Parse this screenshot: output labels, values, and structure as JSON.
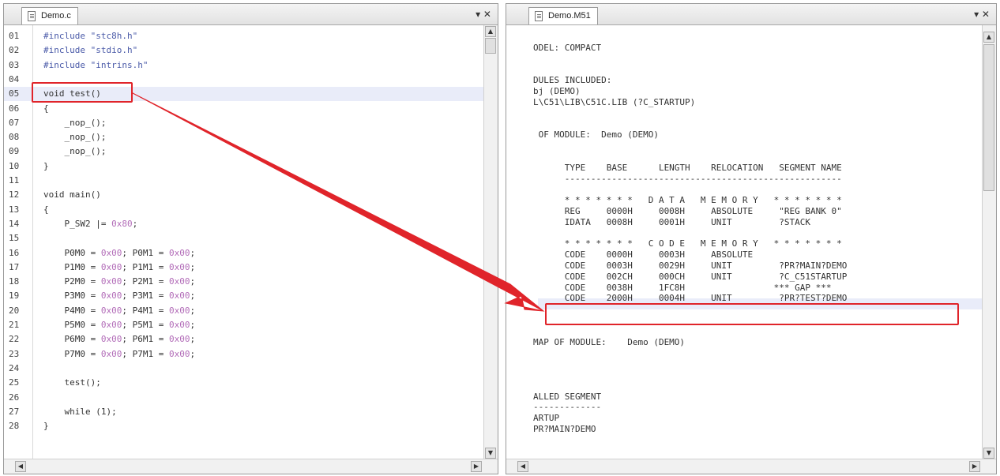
{
  "left_pane": {
    "tab_title": "Demo.c",
    "tab_controls": "▾ ✕",
    "code_lines": [
      {
        "n": "01",
        "parts": [
          {
            "t": "#include \"stc8h.h\"",
            "c": "pp"
          }
        ]
      },
      {
        "n": "02",
        "parts": [
          {
            "t": "#include \"stdio.h\"",
            "c": "pp"
          }
        ]
      },
      {
        "n": "03",
        "parts": [
          {
            "t": "#include \"intrins.h\"",
            "c": "pp"
          }
        ]
      },
      {
        "n": "04",
        "parts": []
      },
      {
        "n": "05",
        "parts": [
          {
            "t": "void test()",
            "c": ""
          }
        ]
      },
      {
        "n": "06",
        "parts": [
          {
            "t": "{",
            "c": ""
          }
        ]
      },
      {
        "n": "07",
        "parts": [
          {
            "t": "    _nop_();",
            "c": ""
          }
        ]
      },
      {
        "n": "08",
        "parts": [
          {
            "t": "    _nop_();",
            "c": ""
          }
        ]
      },
      {
        "n": "09",
        "parts": [
          {
            "t": "    _nop_();",
            "c": ""
          }
        ]
      },
      {
        "n": "10",
        "parts": [
          {
            "t": "}",
            "c": ""
          }
        ]
      },
      {
        "n": "11",
        "parts": []
      },
      {
        "n": "12",
        "parts": [
          {
            "t": "void main()",
            "c": ""
          }
        ]
      },
      {
        "n": "13",
        "parts": [
          {
            "t": "{",
            "c": ""
          }
        ]
      },
      {
        "n": "14",
        "parts": [
          {
            "t": "    P_SW2 |= ",
            "c": ""
          },
          {
            "t": "0x80",
            "c": "hex"
          },
          {
            "t": ";",
            "c": ""
          }
        ]
      },
      {
        "n": "15",
        "parts": []
      },
      {
        "n": "16",
        "parts": [
          {
            "t": "    P0M0 = ",
            "c": ""
          },
          {
            "t": "0x00",
            "c": "hex"
          },
          {
            "t": "; P0M1 = ",
            "c": ""
          },
          {
            "t": "0x00",
            "c": "hex"
          },
          {
            "t": ";",
            "c": ""
          }
        ]
      },
      {
        "n": "17",
        "parts": [
          {
            "t": "    P1M0 = ",
            "c": ""
          },
          {
            "t": "0x00",
            "c": "hex"
          },
          {
            "t": "; P1M1 = ",
            "c": ""
          },
          {
            "t": "0x00",
            "c": "hex"
          },
          {
            "t": ";",
            "c": ""
          }
        ]
      },
      {
        "n": "18",
        "parts": [
          {
            "t": "    P2M0 = ",
            "c": ""
          },
          {
            "t": "0x00",
            "c": "hex"
          },
          {
            "t": "; P2M1 = ",
            "c": ""
          },
          {
            "t": "0x00",
            "c": "hex"
          },
          {
            "t": ";",
            "c": ""
          }
        ]
      },
      {
        "n": "19",
        "parts": [
          {
            "t": "    P3M0 = ",
            "c": ""
          },
          {
            "t": "0x00",
            "c": "hex"
          },
          {
            "t": "; P3M1 = ",
            "c": ""
          },
          {
            "t": "0x00",
            "c": "hex"
          },
          {
            "t": ";",
            "c": ""
          }
        ]
      },
      {
        "n": "20",
        "parts": [
          {
            "t": "    P4M0 = ",
            "c": ""
          },
          {
            "t": "0x00",
            "c": "hex"
          },
          {
            "t": "; P4M1 = ",
            "c": ""
          },
          {
            "t": "0x00",
            "c": "hex"
          },
          {
            "t": ";",
            "c": ""
          }
        ]
      },
      {
        "n": "21",
        "parts": [
          {
            "t": "    P5M0 = ",
            "c": ""
          },
          {
            "t": "0x00",
            "c": "hex"
          },
          {
            "t": "; P5M1 = ",
            "c": ""
          },
          {
            "t": "0x00",
            "c": "hex"
          },
          {
            "t": ";",
            "c": ""
          }
        ]
      },
      {
        "n": "22",
        "parts": [
          {
            "t": "    P6M0 = ",
            "c": ""
          },
          {
            "t": "0x00",
            "c": "hex"
          },
          {
            "t": "; P6M1 = ",
            "c": ""
          },
          {
            "t": "0x00",
            "c": "hex"
          },
          {
            "t": ";",
            "c": ""
          }
        ]
      },
      {
        "n": "23",
        "parts": [
          {
            "t": "    P7M0 = ",
            "c": ""
          },
          {
            "t": "0x00",
            "c": "hex"
          },
          {
            "t": "; P7M1 = ",
            "c": ""
          },
          {
            "t": "0x00",
            "c": "hex"
          },
          {
            "t": ";",
            "c": ""
          }
        ]
      },
      {
        "n": "24",
        "parts": []
      },
      {
        "n": "25",
        "parts": [
          {
            "t": "    test();",
            "c": ""
          }
        ]
      },
      {
        "n": "26",
        "parts": []
      },
      {
        "n": "27",
        "parts": [
          {
            "t": "    while (1);",
            "c": ""
          }
        ]
      },
      {
        "n": "28",
        "parts": [
          {
            "t": "}",
            "c": ""
          }
        ]
      }
    ]
  },
  "right_pane": {
    "tab_title": "Demo.M51",
    "tab_controls": "▾ ✕",
    "lines": [
      "ODEL: COMPACT",
      "",
      "",
      "DULES INCLUDED:",
      "bj (DEMO)",
      "L\\C51\\LIB\\C51C.LIB (?C_STARTUP)",
      "",
      "",
      " OF MODULE:  Demo (DEMO)",
      "",
      "",
      "      TYPE    BASE      LENGTH    RELOCATION   SEGMENT NAME",
      "      -----------------------------------------------------",
      "",
      "      * * * * * * *   D A T A   M E M O R Y   * * * * * * *",
      "      REG     0000H     0008H     ABSOLUTE     \"REG BANK 0\"",
      "      IDATA   0008H     0001H     UNIT         ?STACK",
      "",
      "      * * * * * * *   C O D E   M E M O R Y   * * * * * * *",
      "      CODE    0000H     0003H     ABSOLUTE",
      "      CODE    0003H     0029H     UNIT         ?PR?MAIN?DEMO",
      "      CODE    002CH     000CH     UNIT         ?C_C51STARTUP",
      "      CODE    0038H     1FC8H                 *** GAP ***",
      "      CODE    2000H     0004H     UNIT         ?PR?TEST?DEMO",
      "",
      "",
      "",
      "MAP OF MODULE:    Demo (DEMO)",
      "",
      "",
      "",
      "",
      "ALLED SEGMENT",
      "-------------",
      "ARTUP",
      "PR?MAIN?DEMO"
    ]
  },
  "scroll": {
    "up": "▲",
    "down": "▼",
    "left": "◀",
    "right": "▶"
  },
  "colors": {
    "annotation_red": "#e0242a",
    "line_highlight": "#e9ecf9",
    "preprocessor": "#4a5aa8",
    "hex_literal": "#b26cb8"
  }
}
